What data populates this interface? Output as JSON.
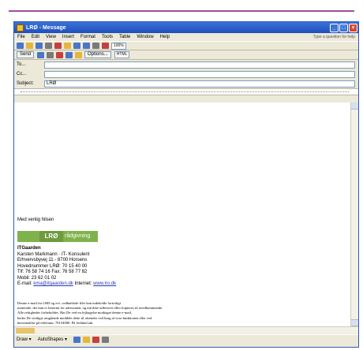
{
  "window": {
    "title": "LRØ - Message",
    "min": "_",
    "max": "□",
    "close": "×"
  },
  "menu": {
    "items": [
      "File",
      "Edit",
      "View",
      "Insert",
      "Format",
      "Tools",
      "Table",
      "Window",
      "Help"
    ],
    "help_placeholder": "Type a question for help"
  },
  "toolbar": {
    "zoom": "100%",
    "format": "HTML",
    "options": "Options..."
  },
  "sendbar": {
    "send": "Send"
  },
  "fields": {
    "to_label": "To...",
    "cc_label": "Cc...",
    "subject_label": "Subject:",
    "subject_value": "LRØ"
  },
  "body": {
    "greeting": "Med venlig hilsen",
    "logo": {
      "part2": "LRØ",
      "part3": "rådgivning"
    },
    "company": {
      "name": "ITGaarden",
      "line1": "Karsten Markmann · IT- Konsulent",
      "line2": "Erhvervsbyvej 11 - 8700 Horsens",
      "line3": "Hovednummer LRØ: 70 15 40 00",
      "line4": "Tlf: 76 58 74 16 Fax: 76 58 77 82",
      "line5": "Mobil: 23 62 01 02",
      "email_label": "E-mail:",
      "email": "kma@itgaarden.dk",
      "internet_label": "Internet:",
      "internet": "www.lro.dk"
    },
    "disclaimer": [
      "Denne e-mail fra LRØ og evt. vedhæftede filer kan indeholde fortroligt",
      "materiale, der kun er bestemt for adressaten, og må ikke udleveres eller kopieres til uvedkommende.",
      "Alle rettigheder forbeholdes. Har De ved en fejltagelse modtaget denne e-mail,",
      "bedes De venligst omgående meddele dette til afsender ved brug af svar-funktionen eller ved",
      "henvendelse på telefonnr. 70154000. På forhånd tak."
    ]
  },
  "drawbar": {
    "draw": "Draw ▾",
    "autoshapes": "AutoShapes ▾"
  },
  "colors": {
    "title_bar": "#2457c5",
    "top_rule": "#9b4f9e",
    "logo_green": "#7fb24a"
  }
}
